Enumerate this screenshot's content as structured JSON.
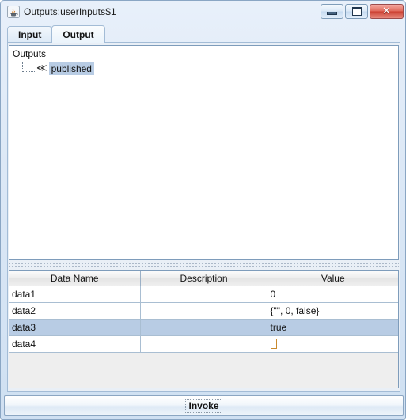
{
  "window": {
    "title": "Outputs:userInputs$1",
    "app_icon": "java-coffee-cup-icon",
    "controls": {
      "minimize_label": "",
      "maximize_label": "",
      "close_label": "✕"
    }
  },
  "tabs": [
    {
      "label": "Input",
      "selected": false
    },
    {
      "label": "Output",
      "selected": true
    }
  ],
  "tree": {
    "root_label": "Outputs",
    "node_icon": "≪",
    "child_label": "published",
    "selection_color": "#b8cce4"
  },
  "table": {
    "columns": [
      "Data Name",
      "Description",
      "Value"
    ],
    "rows": [
      {
        "name": "data1",
        "description": "",
        "value": "0",
        "selected": false
      },
      {
        "name": "data2",
        "description": "",
        "value": "{\"\", 0, false}",
        "selected": false
      },
      {
        "name": "data3",
        "description": "",
        "value": "true",
        "selected": true
      },
      {
        "name": "data4",
        "description": "",
        "value": "□",
        "selected": false
      }
    ]
  },
  "footer": {
    "invoke_label": "Invoke"
  }
}
